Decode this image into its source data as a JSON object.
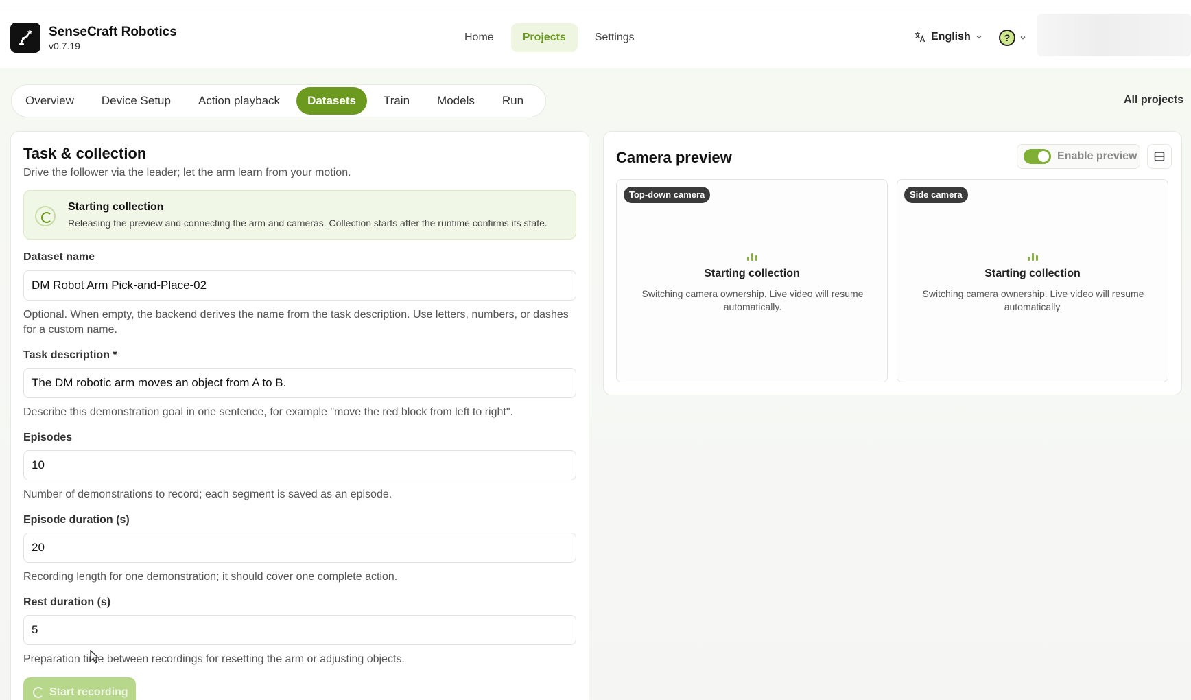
{
  "header": {
    "brand_name": "SenseCraft Robotics",
    "version": "v0.7.19",
    "nav": [
      "Home",
      "Projects",
      "Settings"
    ],
    "active_nav": "Projects",
    "language": "English",
    "help_symbol": "?"
  },
  "project_tabs": {
    "items": [
      "Overview",
      "Device Setup",
      "Action playback",
      "Datasets",
      "Train",
      "Models",
      "Run"
    ],
    "active": "Datasets",
    "all_projects": "All projects"
  },
  "task_card": {
    "title": "Task & collection",
    "subtitle": "Drive the follower via the leader; let the arm learn from your motion.",
    "status": {
      "title": "Starting collection",
      "description": "Releasing the preview and connecting the arm and cameras. Collection starts after the runtime confirms its state."
    },
    "fields": {
      "dataset_name": {
        "label": "Dataset name",
        "value": "DM Robot Arm Pick-and-Place-02",
        "help": "Optional. When empty, the backend derives the name from the task description. Use letters, numbers, or dashes for a custom name."
      },
      "task_description": {
        "label": "Task description *",
        "value": "The DM robotic arm moves an object from A to B.",
        "help": "Describe this demonstration goal in one sentence, for example \"move the red block from left to right\"."
      },
      "episodes": {
        "label": "Episodes",
        "value": "10",
        "help": "Number of demonstrations to record; each segment is saved as an episode."
      },
      "episode_duration": {
        "label": "Episode duration (s)",
        "value": "20",
        "help": "Recording length for one demonstration; it should cover one complete action."
      },
      "rest_duration": {
        "label": "Rest duration (s)",
        "value": "5",
        "help": "Preparation time between recordings for resetting the arm or adjusting objects."
      }
    },
    "start_button": "Start recording"
  },
  "camera_card": {
    "title": "Camera preview",
    "enable_preview_label": "Enable preview",
    "enable_preview_on": true,
    "cameras": [
      {
        "badge": "Top-down camera",
        "state": "Starting collection",
        "description": "Switching camera ownership. Live video will resume automatically."
      },
      {
        "badge": "Side camera",
        "state": "Starting collection",
        "description": "Switching camera ownership. Live video will resume automatically."
      }
    ]
  },
  "colors": {
    "accent": "#6b9a1e",
    "accent_light": "#eef5e1",
    "status_bg": "#f1f7e6"
  }
}
